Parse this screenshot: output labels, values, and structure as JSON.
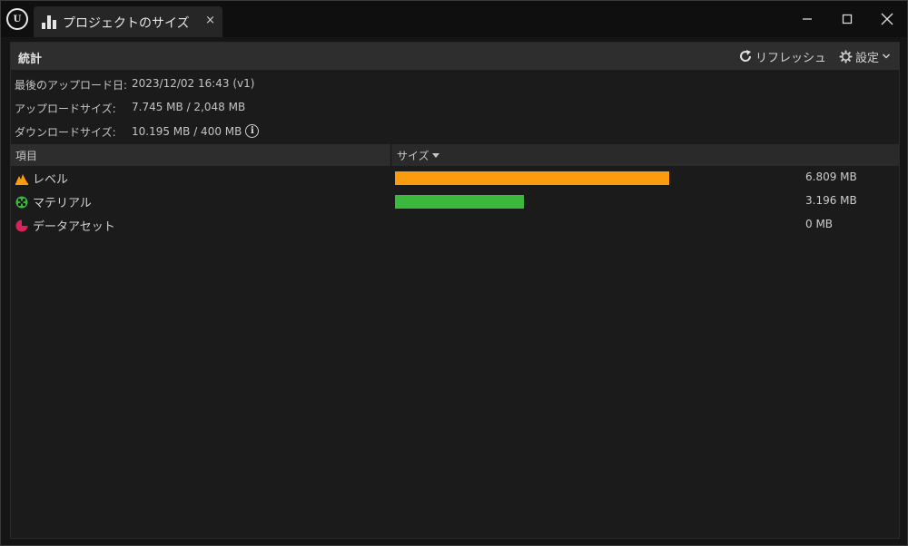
{
  "window": {
    "tab_title": "プロジェクトのサイズ",
    "tab_close": "×"
  },
  "stats": {
    "title": "統計",
    "refresh_label": "リフレッシュ",
    "settings_label": "設定"
  },
  "info": {
    "last_upload_label": "最後のアップロード日:",
    "last_upload_value": "2023/12/02 16:43 (v1)",
    "upload_size_label": "アップロードサイズ:",
    "upload_size_value": "7.745 MB / 2,048 MB",
    "download_size_label": "ダウンロードサイズ:",
    "download_size_value": "10.195 MB / 400 MB"
  },
  "table": {
    "col_item": "項目",
    "col_size": "サイズ",
    "max_size_mb": 6.809,
    "rows": [
      {
        "name": "レベル",
        "size_mb": 6.809,
        "size_label": "6.809 MB",
        "icon": "level-icon",
        "color": "#f99c0d"
      },
      {
        "name": "マテリアル",
        "size_mb": 3.196,
        "size_label": "3.196 MB",
        "icon": "material-icon",
        "color": "#3cb83c"
      },
      {
        "name": "データアセット",
        "size_mb": 0,
        "size_label": "0 MB",
        "icon": "data-asset-icon",
        "color": "#d6245a"
      }
    ]
  }
}
